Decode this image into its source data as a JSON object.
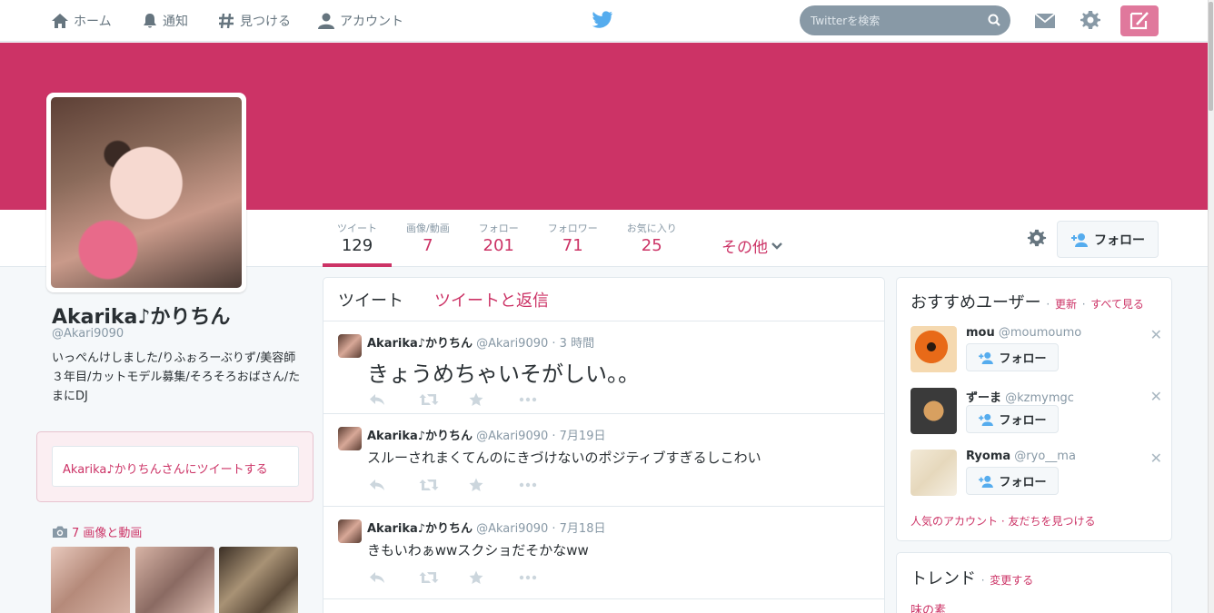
{
  "nav": {
    "home": "ホーム",
    "notifications": "通知",
    "discover": "見つける",
    "account": "アカウント"
  },
  "search": {
    "placeholder": "Twitterを検索"
  },
  "colors": {
    "brand": "#cc3366",
    "twitter_blue": "#55acee",
    "tweet_button": "#e0789c"
  },
  "profile": {
    "name": "Akarika♪かりちん",
    "handle": "@Akari9090",
    "bio": "いっぺんけしました/りふぉろーぶりず/美容師３年目/カットモデル募集/そろそろおばさん/たまにDJ",
    "follow_label": "フォロー"
  },
  "stats": [
    {
      "label": "ツイート",
      "value": "129"
    },
    {
      "label": "画像/動画",
      "value": "7"
    },
    {
      "label": "フォロー",
      "value": "201"
    },
    {
      "label": "フォロワー",
      "value": "71"
    },
    {
      "label": "お気に入り",
      "value": "25"
    }
  ],
  "more_label": "その他",
  "tweet_to": "Akarika♪かりちんさんにツイートする",
  "media": {
    "label": "7 画像と動画"
  },
  "timeline": {
    "tabs": [
      "ツイート",
      "ツイートと返信"
    ],
    "tweets": [
      {
        "name": "Akarika♪かりちん",
        "meta": "@Akari9090 · 3 時間",
        "text": "きょうめちゃいそがしい。。"
      },
      {
        "name": "Akarika♪かりちん",
        "meta": "@Akari9090 · 7月19日",
        "text": "スルーされまくてんのにきづけないのポジティブすぎるしこわい"
      },
      {
        "name": "Akarika♪かりちん",
        "meta": "@Akari9090 · 7月18日",
        "text": "きもいわぁwwスクショだそかなww"
      }
    ]
  },
  "who_to_follow": {
    "title": "おすすめユーザー",
    "sep": "·",
    "refresh": "更新",
    "view_all": "すべて見る",
    "users": [
      {
        "name": "mou",
        "handle": "@moumoumo",
        "follow": "フォロー"
      },
      {
        "name": "ずーま",
        "handle": "@kzmymgc",
        "follow": "フォロー"
      },
      {
        "name": "Ryoma",
        "handle": "@ryo__ma",
        "follow": "フォロー"
      }
    ],
    "popular": "人気のアカウント",
    "find_friends": "友だちを見つける"
  },
  "trends": {
    "title": "トレンド",
    "change": "変更する",
    "items": [
      "味の素"
    ]
  }
}
